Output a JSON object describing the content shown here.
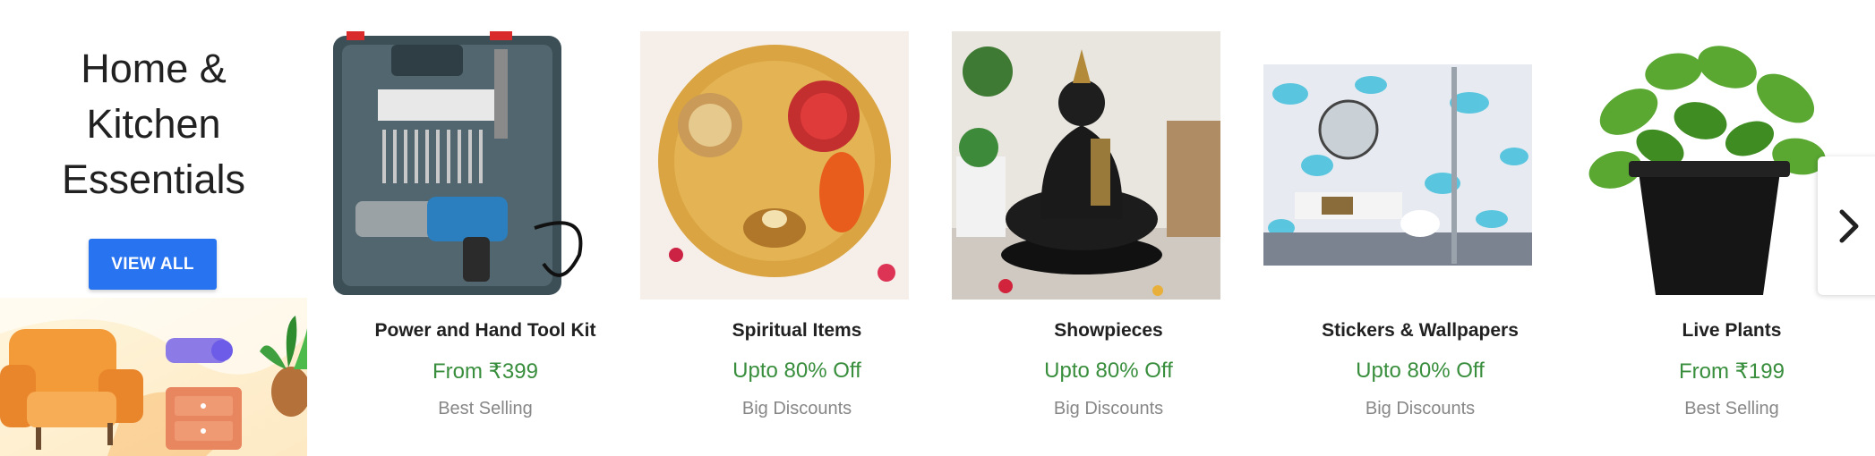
{
  "section": {
    "title": "Home &\nKitchen\nEssentials",
    "view_all_label": "VIEW ALL"
  },
  "cards": [
    {
      "name": "Power and Hand Tool Kit",
      "offer": "From ₹399",
      "tag": "Best Selling"
    },
    {
      "name": "Spiritual Items",
      "offer": "Upto 80% Off",
      "tag": "Big Discounts"
    },
    {
      "name": "Showpieces",
      "offer": "Upto 80% Off",
      "tag": "Big Discounts"
    },
    {
      "name": "Stickers & Wallpapers",
      "offer": "Upto 80% Off",
      "tag": "Big Discounts"
    },
    {
      "name": "Live Plants",
      "offer": "From ₹199",
      "tag": "Best Selling"
    }
  ],
  "next_icon": "chevron-right-icon",
  "colors": {
    "accent": "#2874f0",
    "offer": "#388e3c",
    "muted": "#878787"
  }
}
